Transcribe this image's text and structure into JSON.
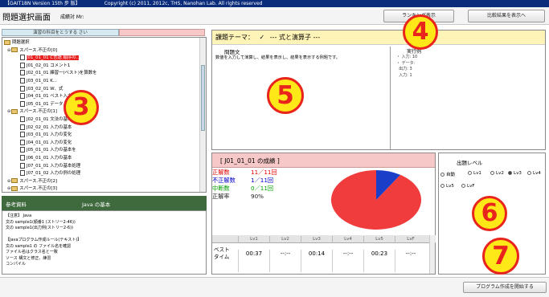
{
  "window": {
    "title": "【GAIT18N Version 15th 步 版】",
    "copyright": "Copyright (c) 2011, 2012c, THS, Nanohan Lab. All rights reserved"
  },
  "header": {
    "screen_title": "問題選択画面",
    "user_label": "成績対 Mr:",
    "button1": "ランキング表示",
    "button2": "比較結果を表示へ"
  },
  "left": {
    "tab1": "演習の科目をとうする さい",
    "tab2": "",
    "root_label": "問題選択",
    "groups": [
      {
        "label": "スパース.不正の[0]",
        "items": [
          "J01_01_01 C言語 順序の..",
          "J01_02_01 コメント1",
          "J02_01_01 練習一(ベスト)を算数を",
          "J03_01_01 K...",
          "J03_02_01 W、式",
          "J04_01_01 ベスト入力の",
          "J05_01_01 データ入力"
        ]
      },
      {
        "label": "スパース.不正の[1]",
        "items": [
          "J02_01_01 文法の基本",
          "J02_02_01 入力の基本",
          "J03_01_01 入力の変化",
          "J04_01_01 入力の変化",
          "J05_01_01 入力の基本を",
          "J06_01_01 入力の基本",
          "J07_01_01 入力の基本処理",
          "J07_01_02 入力の例の処理"
        ]
      },
      {
        "label": "スパース.不正の[2]",
        "items": []
      },
      {
        "label": "スパース.不正の[3]",
        "items": []
      }
    ]
  },
  "teaching": {
    "header": "参考資料",
    "header2": "Java の基本",
    "lines": [
      "【注意】 Java",
      "文の sample1(順番1 (ストリー2-46))",
      "文の sample1(出力例(ストリー2-6))",
      "",
      "【Javaプログラム作成ルール(テキスト)】",
      "文の sample1 の ファイル名を確認",
      "ファイル名はクラス名と一致",
      "ソース 構文と修正、練習",
      "コンパイル"
    ]
  },
  "problem": {
    "title": "課題テーマ：",
    "check": "✓",
    "title_rest": "--- 式と演算子 ---",
    "label": "問題文",
    "text": "数値を入力して演算し、結果を表示し、結果を表示する例題です。",
    "run_label": "実行例",
    "run_lines": [
      "・ 入力: 10",
      "・ データ:",
      "  出力: 3",
      "  入力: 1"
    ]
  },
  "result": {
    "title": "[ J01_01_01 の成績 ]",
    "correct_label": "正解数",
    "correct_value": "11／11回",
    "wrong_label": "不正解数",
    "wrong_value": "1／11回",
    "mid_label": "中断数",
    "mid_value": "0／11回",
    "rate_label": "正解率",
    "rate_value": "90%",
    "levels": [
      "Lv1",
      "Lv2",
      "Lv3",
      "Lv4",
      "Lv5",
      "LvF"
    ],
    "best_label": "ベスト タイム",
    "times": [
      "00:37",
      "--:--",
      "00:14",
      "--:--",
      "00:23",
      "--:--"
    ]
  },
  "level": {
    "title": "出題レベル",
    "options": [
      "自動",
      "Lv1",
      "Lv2",
      "Lv3",
      "Lv4",
      "Lv5",
      "LvF"
    ],
    "selected": "Lv3"
  },
  "footer": {
    "start_button": "プログラム作成を開始する"
  },
  "markers": [
    "3",
    "4",
    "5",
    "6",
    "7"
  ],
  "colors": {
    "pie_red": "#f03c3c",
    "pie_blue": "#1a3ec8",
    "correct": "#e00000",
    "wrong": "#0000c8",
    "mid": "#00a000",
    "marker_ring": "#e8241c",
    "marker_fill": "#ffe818"
  },
  "chart_data": {
    "type": "pie",
    "slices": [
      {
        "name": "正解",
        "value": 91
      },
      {
        "name": "不正解",
        "value": 9
      }
    ]
  }
}
